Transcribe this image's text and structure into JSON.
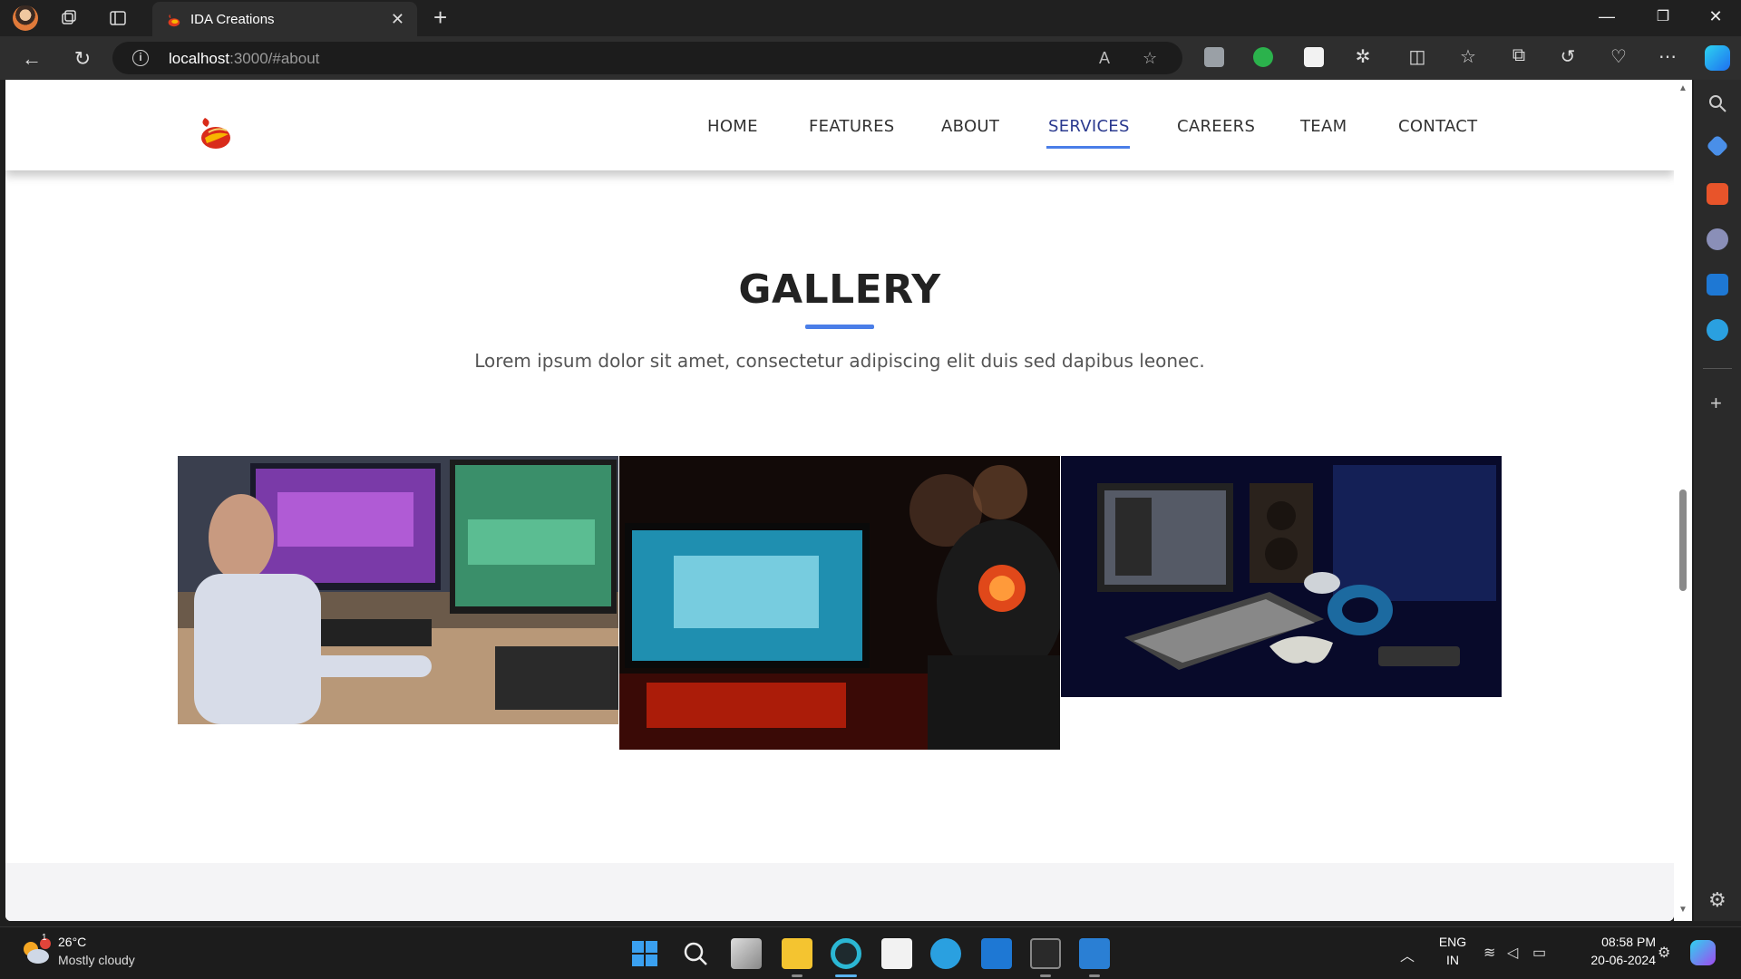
{
  "browser": {
    "tab_title": "IDA Creations",
    "tab_close": "✕",
    "new_tab": "+",
    "url_host": "localhost",
    "url_rest": ":3000/#about",
    "window_min": "—",
    "window_max": "❐",
    "window_close": "✕"
  },
  "site": {
    "nav": [
      "HOME",
      "FEATURES",
      "ABOUT",
      "SERVICES",
      "CAREERS",
      "TEAM",
      "CONTACT"
    ],
    "active_nav": "SERVICES",
    "gallery_title": "GALLERY",
    "gallery_subtitle": "Lorem ipsum dolor sit amet, consectetur adipiscing elit duis sed dapibus leonec."
  },
  "taskbar": {
    "weather_badge": "1",
    "weather_temp": "26°C",
    "weather_desc": "Mostly cloudy",
    "lang_top": "ENG",
    "lang_bottom": "IN",
    "time": "08:58 PM",
    "date": "20-06-2024"
  },
  "colors": {
    "accent": "#4a7ee8",
    "active_nav": "#2b3a8f"
  }
}
